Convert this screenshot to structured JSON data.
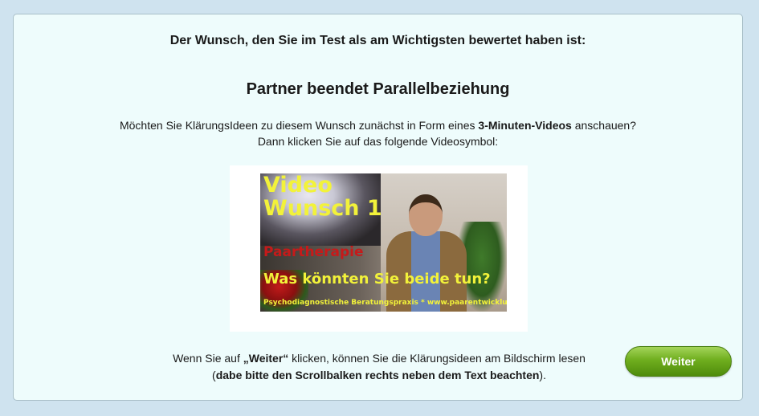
{
  "heading": "Der Wunsch, den Sie im Test als am Wichtigsten bewertet haben ist:",
  "wish_title": "Partner beendet Parallelbeziehung",
  "question": {
    "part1": "Möchten Sie KlärungsIdeen zu diesem Wunsch zunächst in Form eines ",
    "bold": "3-Minuten-Videos",
    "part2": " anschauen?",
    "line2": "Dann klicken Sie auf das folgende Videosymbol:"
  },
  "video": {
    "title_line1": "Video",
    "title_line2": "Wunsch 1",
    "subtitle": "Paartherapie",
    "question": "Was könnten Sie beide tun?",
    "footer": "Psychodiagnostische Beratungspraxis * www.paarentwicklung.eu"
  },
  "info": {
    "part1": "Wenn Sie auf ",
    "bold1": "„Weiter“",
    "part2": " klicken, können Sie die Klärungsideen am Bildschirm lesen (",
    "bold2": "dabe bitte den Scrollbalken rechts neben dem Text beachten",
    "part3": ")."
  },
  "next_button": "Weiter",
  "colors": {
    "page_bg": "#cfe3ef",
    "panel_bg": "#eefcfc",
    "button_green": "#6fae1e",
    "video_yellow": "#f2f23a",
    "video_red": "#c61a1a"
  }
}
